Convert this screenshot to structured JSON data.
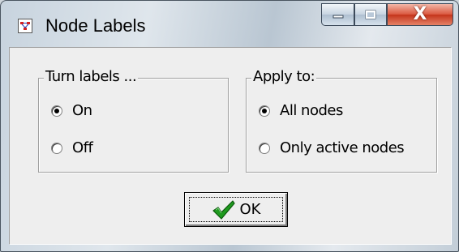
{
  "window": {
    "title": "Node Labels",
    "icon": "node-labels-app-icon"
  },
  "title_buttons": {
    "minimize_icon": "minimize-icon",
    "maximize_icon": "maximize-icon",
    "close_icon": "close-icon",
    "close_glyph": "X"
  },
  "turn_labels": {
    "legend": "Turn labels ...",
    "options": [
      {
        "label": "On",
        "checked": true
      },
      {
        "label": "Off",
        "checked": false
      }
    ]
  },
  "apply_to": {
    "legend": "Apply to:",
    "options": [
      {
        "label": "All nodes",
        "checked": true
      },
      {
        "label": "Only active nodes",
        "checked": false
      }
    ]
  },
  "ok_button": {
    "label": "OK",
    "icon": "checkmark-icon"
  },
  "colors": {
    "close_red": "#c4341b",
    "check_green": "#1e9a1e"
  }
}
